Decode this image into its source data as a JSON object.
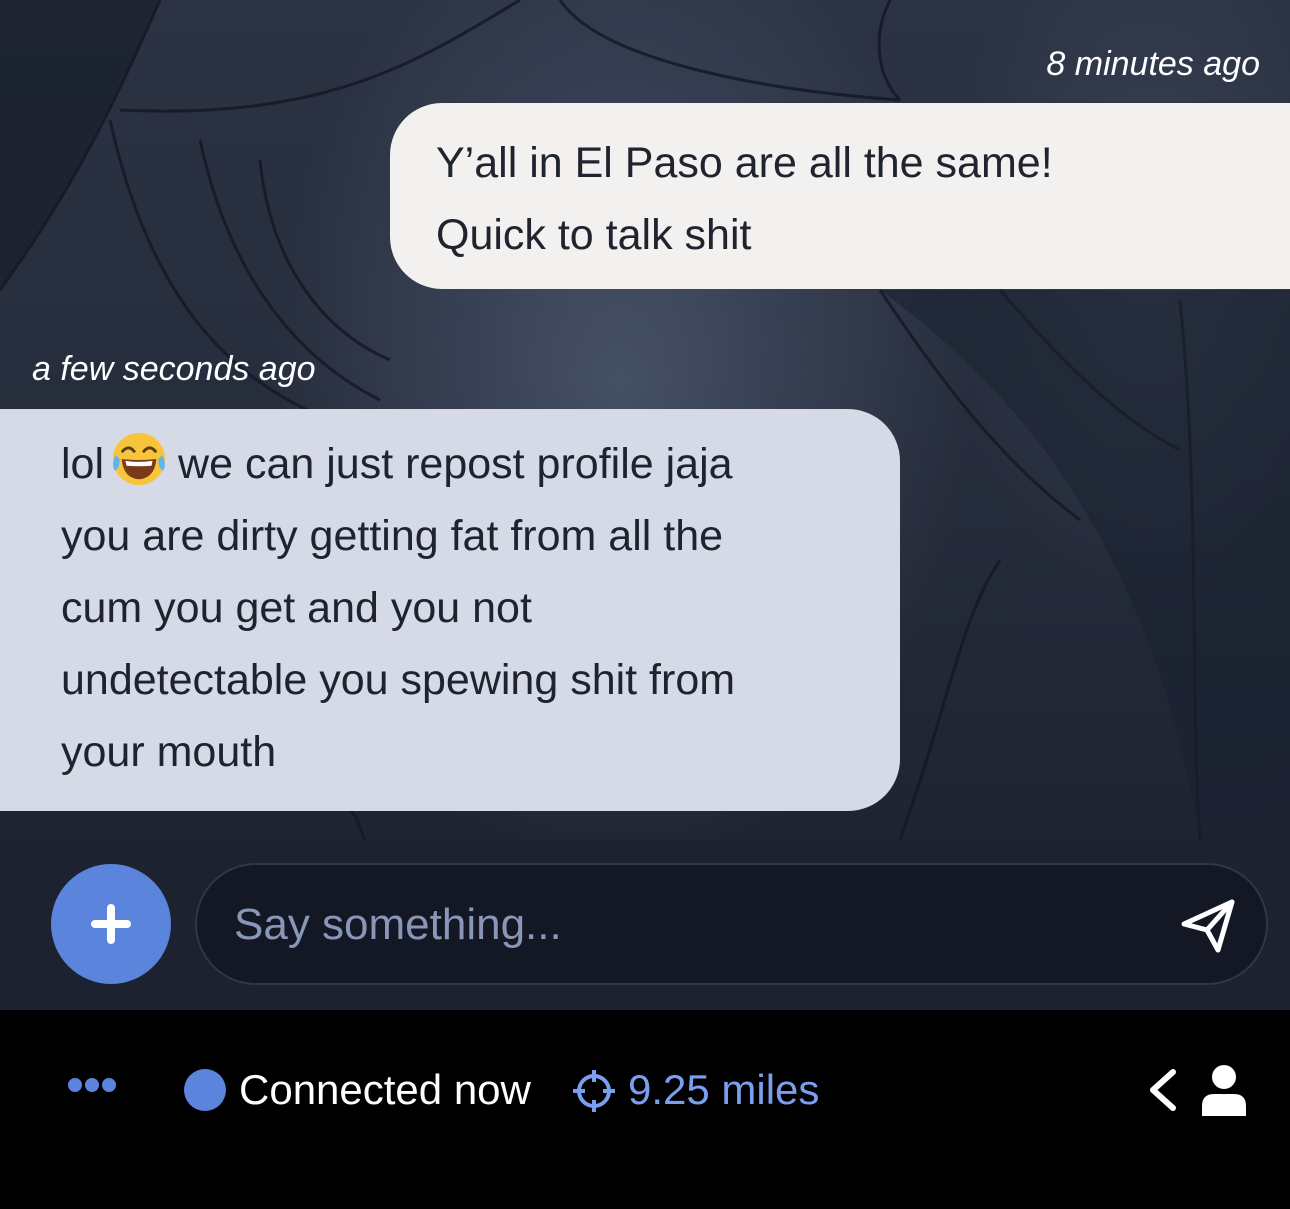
{
  "messages": {
    "outgoing": {
      "timestamp": "8 minutes ago",
      "lines": [
        "Y’all in El Paso are all the same!",
        "Quick to talk shit"
      ]
    },
    "incoming": {
      "timestamp": "a few seconds ago",
      "line1_before_emoji": "lol",
      "emoji": "face-with-tears-of-joy",
      "line1_after_emoji": "we can just repost profile jaja",
      "lines": [
        "you are dirty getting fat from all the",
        "cum you get and you not",
        "undetectable you spewing shit from",
        "your mouth"
      ]
    }
  },
  "composer": {
    "add_icon": "plus-icon",
    "placeholder": "Say something...",
    "send_icon": "paper-plane-icon"
  },
  "status": {
    "more_icon": "ellipsis-icon",
    "connection": "Connected now",
    "distance": "9.25 miles",
    "accent_color": "#5b84dc",
    "back_icon": "chevron-left-icon",
    "profile_icon": "person-icon"
  }
}
